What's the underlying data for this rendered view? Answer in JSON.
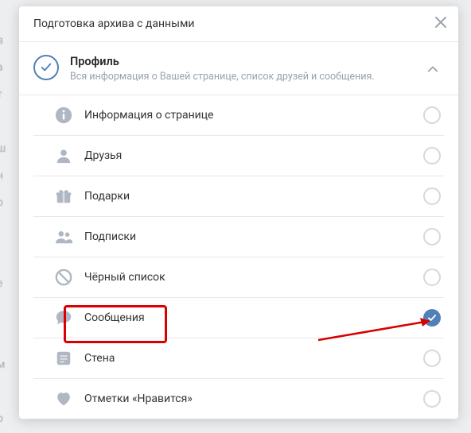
{
  "dialog": {
    "title": "Подготовка архива с данными"
  },
  "section": {
    "title": "Профиль",
    "description": "Вся информация о Вашей странице, список друзей и сообщения."
  },
  "rows": [
    {
      "id": "info",
      "label": "Информация о странице",
      "checked": false
    },
    {
      "id": "friends",
      "label": "Друзья",
      "checked": false
    },
    {
      "id": "gifts",
      "label": "Подарки",
      "checked": false
    },
    {
      "id": "subs",
      "label": "Подписки",
      "checked": false
    },
    {
      "id": "blacklist",
      "label": "Чёрный список",
      "checked": false
    },
    {
      "id": "messages",
      "label": "Сообщения",
      "checked": true
    },
    {
      "id": "wall",
      "label": "Стена",
      "checked": false
    },
    {
      "id": "likes",
      "label": "Отметки «Нравится»",
      "checked": false
    }
  ],
  "colors": {
    "accent": "#5181b8",
    "icon": "#aeb7c2",
    "danger": "#d80000"
  }
}
